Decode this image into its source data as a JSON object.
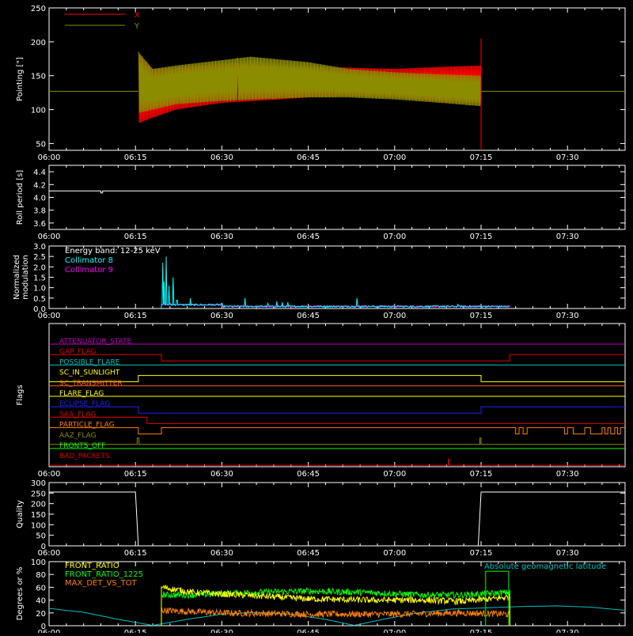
{
  "time_axis": {
    "start": "06:00",
    "end": "07:40",
    "ticks": [
      "06:00",
      "06:15",
      "06:30",
      "06:45",
      "07:00",
      "07:15",
      "07:30"
    ],
    "tick_minutes": [
      0,
      15,
      30,
      45,
      60,
      75,
      90
    ]
  },
  "chart_data": [
    {
      "type": "line",
      "ylabel": "Pointing [\"]",
      "ylim": [
        40,
        250
      ],
      "yticks": [
        50,
        100,
        150,
        200,
        250
      ],
      "legend": "top-left",
      "series": [
        {
          "name": "X",
          "color": "#ff0000",
          "baseline": 127,
          "active_start_min": 15.5,
          "active_end_min": 75.0,
          "envelope": [
            [
              15.5,
              80,
              185
            ],
            [
              18,
              88,
              160
            ],
            [
              22,
              100,
              162
            ],
            [
              30,
              110,
              168
            ],
            [
              40,
              115,
              165
            ],
            [
              45,
              118,
              163
            ],
            [
              52,
              120,
              162
            ],
            [
              60,
              118,
              160
            ],
            [
              68,
              112,
              163
            ],
            [
              75,
              110,
              165
            ]
          ]
        },
        {
          "name": "Y",
          "color": "#8c8c00",
          "baseline": 127,
          "active_start_min": 15.5,
          "active_end_min": 75.0,
          "envelope": [
            [
              15.5,
              95,
              185
            ],
            [
              18,
              100,
              160
            ],
            [
              22,
              108,
              165
            ],
            [
              30,
              113,
              173
            ],
            [
              35,
              115,
              178
            ],
            [
              45,
              118,
              170
            ],
            [
              52,
              118,
              160
            ],
            [
              60,
              115,
              155
            ],
            [
              68,
              110,
              152
            ],
            [
              75,
              105,
              150
            ]
          ]
        }
      ]
    },
    {
      "type": "line",
      "ylabel": "Roll period [s]",
      "ylim": [
        3.5,
        4.5
      ],
      "yticks": [
        "3.6",
        "3.8",
        "4.0",
        "4.2",
        "4.4"
      ],
      "series": [
        {
          "name": "",
          "color": "#ffffff",
          "constant": 4.1,
          "dip_min": 9.0,
          "dip_value": 4.07
        }
      ]
    },
    {
      "type": "line",
      "ylabel": "Normalized modulation",
      "ylim": [
        0,
        3.0
      ],
      "yticks": [
        "0.0",
        "0.5",
        "1.0",
        "1.5",
        "2.0",
        "2.5",
        "3.0"
      ],
      "legend": "top-left",
      "annotations": [
        "Energy band: 12-25 keV"
      ],
      "series": [
        {
          "name": "Collimator 8",
          "color": "#00ffff",
          "active_start_min": 19.5,
          "active_end_min": 80.0,
          "spikes": [
            [
              19.7,
              2.2
            ],
            [
              20.0,
              1.3
            ],
            [
              20.3,
              2.5
            ],
            [
              20.8,
              1.1
            ],
            [
              21.5,
              1.5
            ],
            [
              22.2,
              0.4
            ],
            [
              24.5,
              0.5
            ],
            [
              30.0,
              0.25
            ],
            [
              34.0,
              0.5
            ],
            [
              38.0,
              0.25
            ],
            [
              39.5,
              0.35
            ],
            [
              40.5,
              0.3
            ],
            [
              41.5,
              0.3
            ],
            [
              53.5,
              0.5
            ],
            [
              71.0,
              0.2
            ]
          ]
        },
        {
          "name": "Collimator 9",
          "color": "#ff00ff",
          "active_start_min": 19.5,
          "active_end_min": 80.0,
          "spikes": [
            [
              20.0,
              0.3
            ],
            [
              21.0,
              0.25
            ],
            [
              23.0,
              0.2
            ]
          ]
        }
      ]
    },
    {
      "type": "line",
      "ylabel": "Flags",
      "flags": [
        {
          "name": "ATTENUATOR_STATE",
          "color": "#c000c0",
          "transitions": []
        },
        {
          "name": "GAP_FLAG",
          "color": "#e00000",
          "transitions": [
            [
              0,
              1
            ],
            [
              19.5,
              0
            ],
            [
              80,
              1
            ]
          ]
        },
        {
          "name": "POSSIBLE_FLARE",
          "color": "#00c0c0",
          "transitions": []
        },
        {
          "name": "SC_IN_SUNLIGHT",
          "color": "#ffff00",
          "transitions": [
            [
              0,
              0
            ],
            [
              15.5,
              1
            ],
            [
              75.0,
              0
            ]
          ]
        },
        {
          "name": "SC_TRANSMITTER",
          "color": "#ff6020",
          "transitions": []
        },
        {
          "name": "FLARE_FLAG",
          "color": "#ffff00",
          "transitions": []
        },
        {
          "name": "ECLIPSE_FLAG",
          "color": "#2020ff",
          "transitions": [
            [
              0,
              1
            ],
            [
              15.5,
              0
            ],
            [
              75.0,
              1
            ]
          ]
        },
        {
          "name": "SAA_FLAG",
          "color": "#e00000",
          "transitions": [
            [
              0,
              1
            ],
            [
              17.0,
              0
            ]
          ]
        },
        {
          "name": "PARTICLE_FLAG",
          "color": "#ff7f00",
          "transitions": [
            [
              0,
              1
            ],
            [
              15.5,
              0
            ],
            [
              19.5,
              1
            ],
            [
              81.0,
              0
            ],
            [
              81.6,
              1
            ],
            [
              82.3,
              0
            ],
            [
              83.0,
              1
            ],
            [
              89.5,
              0
            ],
            [
              90.0,
              1
            ],
            [
              91.0,
              0
            ],
            [
              93.0,
              1
            ],
            [
              94.0,
              0
            ],
            [
              96.0,
              1
            ],
            [
              96.5,
              0
            ],
            [
              97.0,
              1
            ],
            [
              97.5,
              0
            ],
            [
              98.2,
              1
            ],
            [
              98.7,
              0
            ],
            [
              99.2,
              1
            ]
          ]
        },
        {
          "name": "AAZ_FLAG",
          "color": "#8c8c00",
          "transitions": [
            [
              0,
              0
            ],
            [
              15.3,
              1
            ],
            [
              15.6,
              0
            ],
            [
              74.8,
              1
            ],
            [
              75.0,
              0
            ]
          ]
        },
        {
          "name": "FRONTS_OFF",
          "color": "#00ff00",
          "transitions": []
        },
        {
          "name": "BAD_PACKETS",
          "color": "#e00000",
          "transitions": [
            [
              0,
              0
            ],
            [
              69.3,
              1
            ],
            [
              69.5,
              0
            ]
          ]
        }
      ]
    },
    {
      "type": "line",
      "ylabel": "Quality",
      "ylim": [
        0,
        300
      ],
      "yticks": [
        "0",
        "50",
        "100",
        "150",
        "200",
        "250",
        "300"
      ],
      "series": [
        {
          "name": "",
          "color": "#ffffff",
          "points": [
            [
              0,
              255
            ],
            [
              15.0,
              255
            ],
            [
              15.5,
              0
            ],
            [
              74.5,
              0
            ],
            [
              75.0,
              255
            ],
            [
              100,
              255
            ]
          ]
        }
      ]
    },
    {
      "type": "line",
      "ylabel": "Degrees or %",
      "ylim": [
        0,
        100
      ],
      "yticks": [
        "0",
        "20",
        "40",
        "60",
        "80",
        "100"
      ],
      "legend": "top-left",
      "series": [
        {
          "name": "FRONT_RATIO",
          "color": "#ffff00",
          "active_start_min": 19.5,
          "active_end_min": 80.0,
          "curve": [
            [
              19.5,
              60
            ],
            [
              25,
              52
            ],
            [
              35,
              47
            ],
            [
              45,
              42
            ],
            [
              55,
              40
            ],
            [
              65,
              40
            ],
            [
              72,
              38
            ],
            [
              77,
              42
            ],
            [
              80,
              45
            ]
          ]
        },
        {
          "name": "FRONT_RATIO_1225",
          "color": "#00ff00",
          "active_start_min": 19.5,
          "active_end_min": 80.0,
          "curve": [
            [
              19.5,
              48
            ],
            [
              25,
              48
            ],
            [
              35,
              52
            ],
            [
              45,
              54
            ],
            [
              55,
              52
            ],
            [
              65,
              48
            ],
            [
              72,
              48
            ],
            [
              76,
              50
            ],
            [
              80,
              52
            ]
          ]
        },
        {
          "name": "MAX_DET_VS_TOT",
          "color": "#ff8000",
          "active_start_min": 19.5,
          "active_end_min": 80.0,
          "curve": [
            [
              19.5,
              24
            ],
            [
              30,
              20
            ],
            [
              45,
              18
            ],
            [
              60,
              18
            ],
            [
              72,
              20
            ],
            [
              80,
              18
            ]
          ]
        },
        {
          "name": "Absolute geomagnetic latitude",
          "color": "#00c0c0",
          "points": [
            [
              0,
              27
            ],
            [
              6,
              21
            ],
            [
              12,
              10
            ],
            [
              18,
              0.5
            ],
            [
              24,
              10
            ],
            [
              30,
              18
            ],
            [
              36,
              21
            ],
            [
              42,
              18
            ],
            [
              48,
              10
            ],
            [
              53,
              0.5
            ],
            [
              58,
              10
            ],
            [
              64,
              20
            ],
            [
              70,
              26
            ],
            [
              76,
              28
            ],
            [
              82,
              30
            ],
            [
              88,
              31
            ],
            [
              94,
              29
            ],
            [
              100,
              24
            ]
          ]
        },
        {
          "name": "",
          "color": "#00ff00",
          "box": [
            [
              75.8,
              0
            ],
            [
              75.8,
              85
            ],
            [
              79.8,
              85
            ],
            [
              79.8,
              0
            ]
          ]
        }
      ]
    }
  ]
}
